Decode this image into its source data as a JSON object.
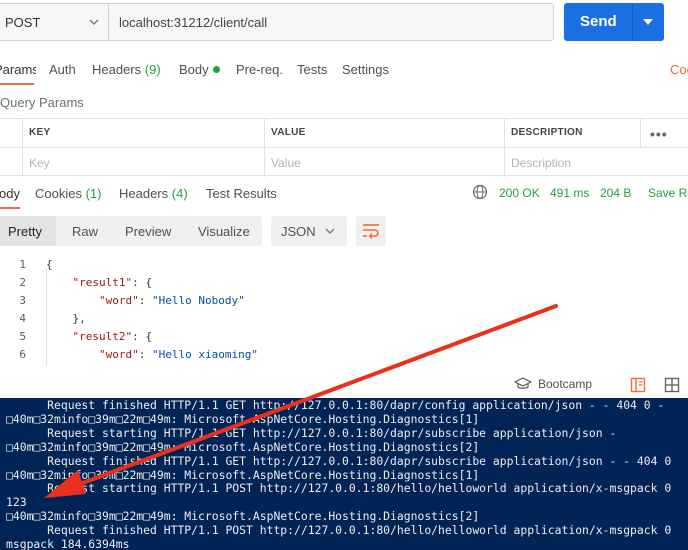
{
  "request": {
    "method": "POST",
    "url": "localhost:31212/client/call",
    "send_label": "Send"
  },
  "request_tabs": {
    "params": "Params",
    "auth": "Auth",
    "headers": "Headers",
    "headers_count": "(9)",
    "body": "Body",
    "prereq": "Pre-req.",
    "tests": "Tests",
    "settings": "Settings",
    "cookies_link": "Cookies"
  },
  "query_params": {
    "title": "Query Params",
    "columns": [
      "KEY",
      "VALUE",
      "DESCRIPTION"
    ],
    "placeholders": [
      "Key",
      "Value",
      "Description"
    ],
    "more": "•••"
  },
  "response_tabs": {
    "body": "Body",
    "cookies": "Cookies",
    "cookies_count": "(1)",
    "headers": "Headers",
    "headers_count": "(4)",
    "test_results": "Test Results"
  },
  "response_status": {
    "status": "200 OK",
    "time": "491 ms",
    "size": "204 B",
    "save": "Save Response"
  },
  "view_modes": [
    "Pretty",
    "Raw",
    "Preview",
    "Visualize"
  ],
  "format": "JSON",
  "code_lines": [
    {
      "n": "1",
      "indent": "",
      "parts": [
        {
          "t": "{",
          "c": "p"
        }
      ]
    },
    {
      "n": "2",
      "indent": "    ",
      "parts": [
        {
          "t": "\"result1\"",
          "c": "k"
        },
        {
          "t": ": {",
          "c": "p"
        }
      ]
    },
    {
      "n": "3",
      "indent": "        ",
      "parts": [
        {
          "t": "\"word\"",
          "c": "k"
        },
        {
          "t": ": ",
          "c": "p"
        },
        {
          "t": "\"Hello Nobody\"",
          "c": "s"
        }
      ]
    },
    {
      "n": "4",
      "indent": "    ",
      "parts": [
        {
          "t": "},",
          "c": "p"
        }
      ]
    },
    {
      "n": "5",
      "indent": "    ",
      "parts": [
        {
          "t": "\"result2\"",
          "c": "k"
        },
        {
          "t": ": {",
          "c": "p"
        }
      ]
    },
    {
      "n": "6",
      "indent": "        ",
      "parts": [
        {
          "t": "\"word\"",
          "c": "k"
        },
        {
          "t": ": ",
          "c": "p"
        },
        {
          "t": "\"Hello xiaoming\"",
          "c": "s"
        }
      ]
    }
  ],
  "bottom_bar": {
    "bootcamp": "Bootcamp"
  },
  "console_lines": [
    "      Request finished HTTP/1.1 GET http://127.0.0.1:80/dapr/config application/json - - 404 0 -",
    "□40m□32minfo□39m□22m□49m: Microsoft.AspNetCore.Hosting.Diagnostics[1]",
    "      Request starting HTTP/1.1 GET http://127.0.0.1:80/dapr/subscribe application/json -",
    "□40m□32minfo□39m□22m□49m: Microsoft.AspNetCore.Hosting.Diagnostics[2]",
    "      Request finished HTTP/1.1 GET http://127.0.0.1:80/dapr/subscribe application/json - - 404 0",
    "□40m□32minfo□39m□22m□49m: Microsoft.AspNetCore.Hosting.Diagnostics[1]",
    "      Request starting HTTP/1.1 POST http://127.0.0.1:80/hello/helloworld application/x-msgpack 0",
    "123",
    "□40m□32minfo□39m□22m□49m: Microsoft.AspNetCore.Hosting.Diagnostics[2]",
    "      Request finished HTTP/1.1 POST http://127.0.0.1:80/hello/helloworld application/x-msgpack 0",
    "msgpack 184.6394ms"
  ],
  "colors": {
    "send": "#1c6fe3",
    "accent": "#f26b3a",
    "success": "#2a9d3f",
    "console_bg": "#012456",
    "annotation_arrow": "#e8301c"
  }
}
